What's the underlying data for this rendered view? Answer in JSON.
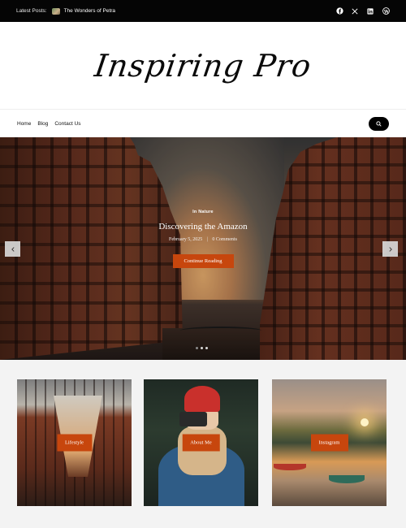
{
  "topbar": {
    "latest_label": "Latest Posts:",
    "latest_post_title": "The Wonders of Petra",
    "social": [
      {
        "name": "facebook-icon"
      },
      {
        "name": "x-icon"
      },
      {
        "name": "linkedin-icon"
      },
      {
        "name": "wordpress-icon"
      }
    ]
  },
  "header": {
    "site_title": "Inspiring Pro"
  },
  "nav": {
    "items": [
      "Home",
      "Blog",
      "Contact Us"
    ],
    "search_icon": "search-icon"
  },
  "hero": {
    "category": "In Nature",
    "title": "Discovering the Amazon",
    "date": "February 5, 2025",
    "comments": "0 Comments",
    "button_label": "Continue Reading",
    "slide_count": 3,
    "active_slide": 1
  },
  "cards": [
    {
      "label": "Lifestyle"
    },
    {
      "label": "About Me"
    },
    {
      "label": "Instagram"
    }
  ],
  "colors": {
    "accent": "#c7460d",
    "topbar_bg": "#050505",
    "section_bg": "#f3f3f3"
  }
}
